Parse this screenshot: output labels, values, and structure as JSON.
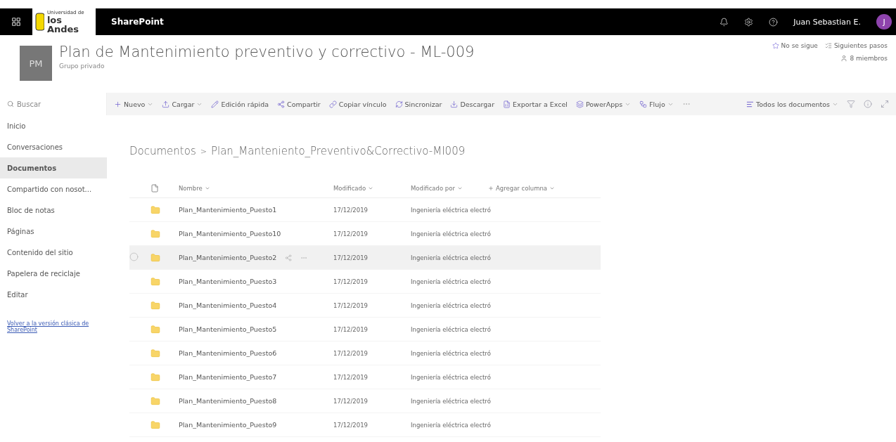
{
  "top_bar": {
    "logo_line1": "Universidad de",
    "logo_line2": "los Andes",
    "app": "SharePoint",
    "user": "Juan Sebastian E.",
    "avatar": "J"
  },
  "site": {
    "initials": "PM",
    "title": "Plan de Mantenimiento preventivo y correctivo - ML-009",
    "subtitle": "Grupo privado",
    "follow": "No se sigue",
    "next_steps": "Siguientes pasos",
    "members": "8 miembros"
  },
  "search": {
    "placeholder": "Buscar"
  },
  "sidebar": {
    "items": [
      {
        "label": "Inicio",
        "selected": false
      },
      {
        "label": "Conversaciones",
        "selected": false
      },
      {
        "label": "Documentos",
        "selected": true
      },
      {
        "label": "Compartido con nosot...",
        "selected": false
      },
      {
        "label": "Bloc de notas",
        "selected": false
      },
      {
        "label": "Páginas",
        "selected": false
      },
      {
        "label": "Contenido del sitio",
        "selected": false
      },
      {
        "label": "Papelera de reciclaje",
        "selected": false
      },
      {
        "label": "Editar",
        "selected": false
      }
    ],
    "classic_link": "Volver a la versión clásica de SharePoint"
  },
  "toolbar": {
    "items": [
      {
        "kind": "new",
        "label": "Nuevo",
        "dropdown": true
      },
      {
        "kind": "upload",
        "label": "Cargar",
        "dropdown": true
      },
      {
        "kind": "edit",
        "label": "Edición rápida",
        "dropdown": false
      },
      {
        "kind": "share",
        "label": "Compartir",
        "dropdown": false
      },
      {
        "kind": "link",
        "label": "Copiar vínculo",
        "dropdown": false
      },
      {
        "kind": "sync",
        "label": "Sincronizar",
        "dropdown": false
      },
      {
        "kind": "download",
        "label": "Descargar",
        "dropdown": false
      },
      {
        "kind": "excel",
        "label": "Exportar a Excel",
        "dropdown": false
      },
      {
        "kind": "powerapps",
        "label": "PowerApps",
        "dropdown": true
      },
      {
        "kind": "flow",
        "label": "Flujo",
        "dropdown": true
      }
    ],
    "view": "Todos los documentos"
  },
  "breadcrumb": [
    "Documentos",
    ">",
    "Plan_Manteniento_Preventivo&Correctivo-MI009"
  ],
  "table": {
    "columns": [
      "Nombre",
      "Modificado",
      "Modificado por",
      "Agregar columna"
    ],
    "rows": [
      {
        "name": "Plan_Mantenimiento_Puesto1",
        "modified": "17/12/2019",
        "modified_by": "Ingeniería eléctrica electró",
        "highlighted": false
      },
      {
        "name": "Plan_Mantenimiento_Puesto10",
        "modified": "17/12/2019",
        "modified_by": "Ingeniería eléctrica electró",
        "highlighted": false
      },
      {
        "name": "Plan_Mantenimiento_Puesto2",
        "modified": "17/12/2019",
        "modified_by": "Ingeniería eléctrica electró",
        "highlighted": true
      },
      {
        "name": "Plan_Mantenimiento_Puesto3",
        "modified": "17/12/2019",
        "modified_by": "Ingeniería eléctrica electró",
        "highlighted": false
      },
      {
        "name": "Plan_Mantenimiento_Puesto4",
        "modified": "17/12/2019",
        "modified_by": "Ingeniería eléctrica electró",
        "highlighted": false
      },
      {
        "name": "Plan_Mantenimiento_Puesto5",
        "modified": "17/12/2019",
        "modified_by": "Ingeniería eléctrica electró",
        "highlighted": false
      },
      {
        "name": "Plan_Mantenimiento_Puesto6",
        "modified": "17/12/2019",
        "modified_by": "Ingeniería eléctrica electró",
        "highlighted": false
      },
      {
        "name": "Plan_Mantenimiento_Puesto7",
        "modified": "17/12/2019",
        "modified_by": "Ingeniería eléctrica electró",
        "highlighted": false
      },
      {
        "name": "Plan_Mantenimiento_Puesto8",
        "modified": "17/12/2019",
        "modified_by": "Ingeniería eléctrica electró",
        "highlighted": false
      },
      {
        "name": "Plan_Mantenimiento_Puesto9",
        "modified": "17/12/2019",
        "modified_by": "Ingeniería eléctrica electró",
        "highlighted": false
      }
    ]
  }
}
